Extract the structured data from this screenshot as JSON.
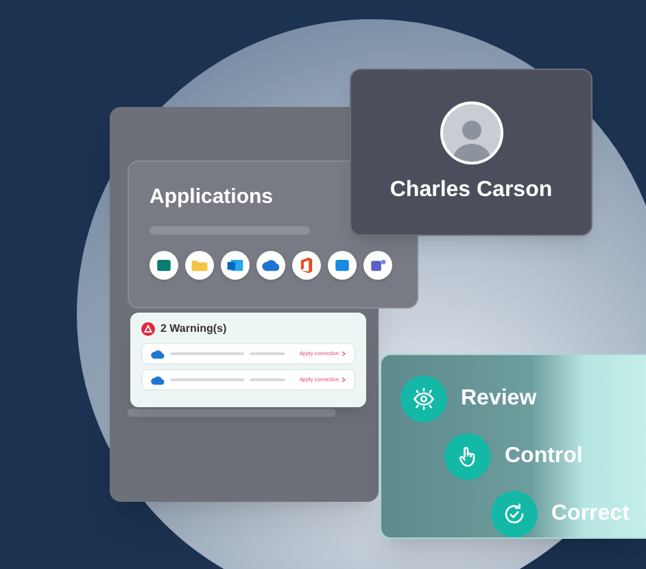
{
  "profile": {
    "name": "Charles Carson"
  },
  "applications": {
    "title": "Applications"
  },
  "warnings": {
    "title": "2 Warning(s)",
    "rows": [
      {
        "action": "Apply correction"
      },
      {
        "action": "Apply correction"
      }
    ]
  },
  "steps": [
    {
      "kind": "eye",
      "label": "Review"
    },
    {
      "kind": "hand",
      "label": "Control"
    },
    {
      "kind": "refresh-check",
      "label": "Correct"
    }
  ]
}
